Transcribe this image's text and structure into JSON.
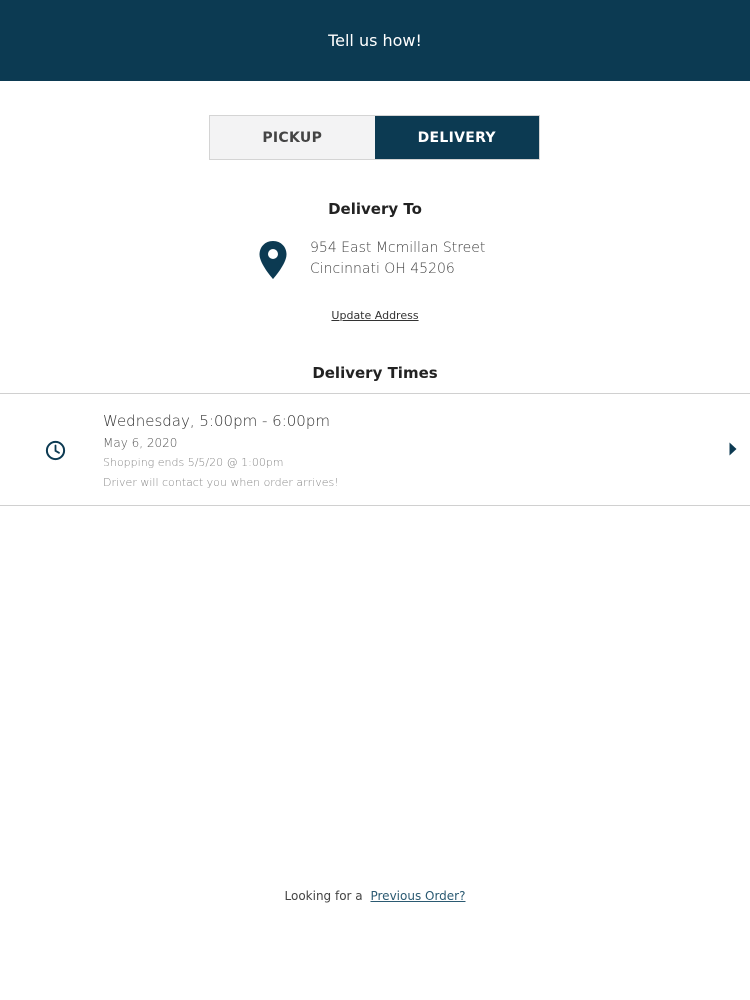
{
  "header": {
    "title": "Tell us how!"
  },
  "fulfillment_toggle": {
    "options": [
      {
        "label": "PICKUP",
        "selected": false
      },
      {
        "label": "DELIVERY",
        "selected": true
      }
    ]
  },
  "delivery_to": {
    "heading": "Delivery To",
    "icon": "map-pin-icon",
    "address_line1": "954 East Mcmillan Street",
    "address_line2": "Cincinnati OH 45206",
    "update_link": "Update Address"
  },
  "delivery_times": {
    "heading": "Delivery Times",
    "slot": {
      "icon": "clock-icon",
      "title": "Wednesday, 5:00pm - 6:00pm",
      "date": "May 6, 2020",
      "shopping_ends": "Shopping ends 5/5/20 @ 1:00pm",
      "note": "Driver will contact you when order arrives!",
      "action_icon": "chevron-right-icon"
    }
  },
  "footer": {
    "prefix": "Looking for a",
    "link": "Previous Order?"
  },
  "colors": {
    "brand": "#0c3a52",
    "background": "#ffffff",
    "toggle_inactive": "#f3f3f4",
    "divider": "#d0d0d0"
  }
}
